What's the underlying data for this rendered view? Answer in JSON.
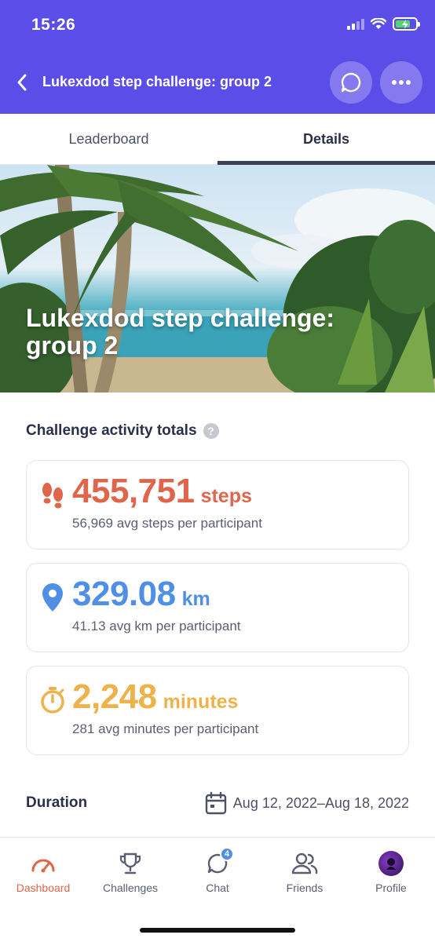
{
  "status_bar": {
    "time": "15:26"
  },
  "header": {
    "title": "Lukexdod step challenge: group 2",
    "icons": {
      "back": "chevron-left-icon",
      "chat": "chat-bubble-icon",
      "more": "more-horizontal-icon"
    }
  },
  "tabs": [
    {
      "label": "Leaderboard",
      "active": false
    },
    {
      "label": "Details",
      "active": true
    }
  ],
  "hero": {
    "title": "Lukexdod step challenge: group 2"
  },
  "totals": {
    "title": "Challenge activity totals",
    "help_glyph": "?",
    "cards": [
      {
        "value": "455,751",
        "unit": "steps",
        "sub": "56,969 avg steps per participant",
        "icon": "footprints-icon",
        "color": "#e0664b"
      },
      {
        "value": "329.08",
        "unit": "km",
        "sub": "41.13 avg km per participant",
        "icon": "location-pin-icon",
        "color": "#4f8fe6"
      },
      {
        "value": "2,248",
        "unit": "minutes",
        "sub": "281 avg minutes per participant",
        "icon": "stopwatch-icon",
        "color": "#edb34a"
      }
    ]
  },
  "duration": {
    "label": "Duration",
    "value": "Aug 12, 2022–Aug 18, 2022",
    "icon": "calendar-icon"
  },
  "bottom_nav": [
    {
      "label": "Dashboard",
      "icon": "gauge-icon",
      "active": true
    },
    {
      "label": "Challenges",
      "icon": "trophy-icon",
      "active": false
    },
    {
      "label": "Chat",
      "icon": "chat-bubble-icon",
      "active": false,
      "badge": "4"
    },
    {
      "label": "Friends",
      "icon": "friends-icon",
      "active": false
    },
    {
      "label": "Profile",
      "icon": "avatar-icon",
      "active": false
    }
  ],
  "colors": {
    "header": "#5b4de8",
    "steps": "#e0664b",
    "km": "#4f8fe6",
    "minutes": "#edb34a",
    "active_nav": "#e0664b"
  }
}
